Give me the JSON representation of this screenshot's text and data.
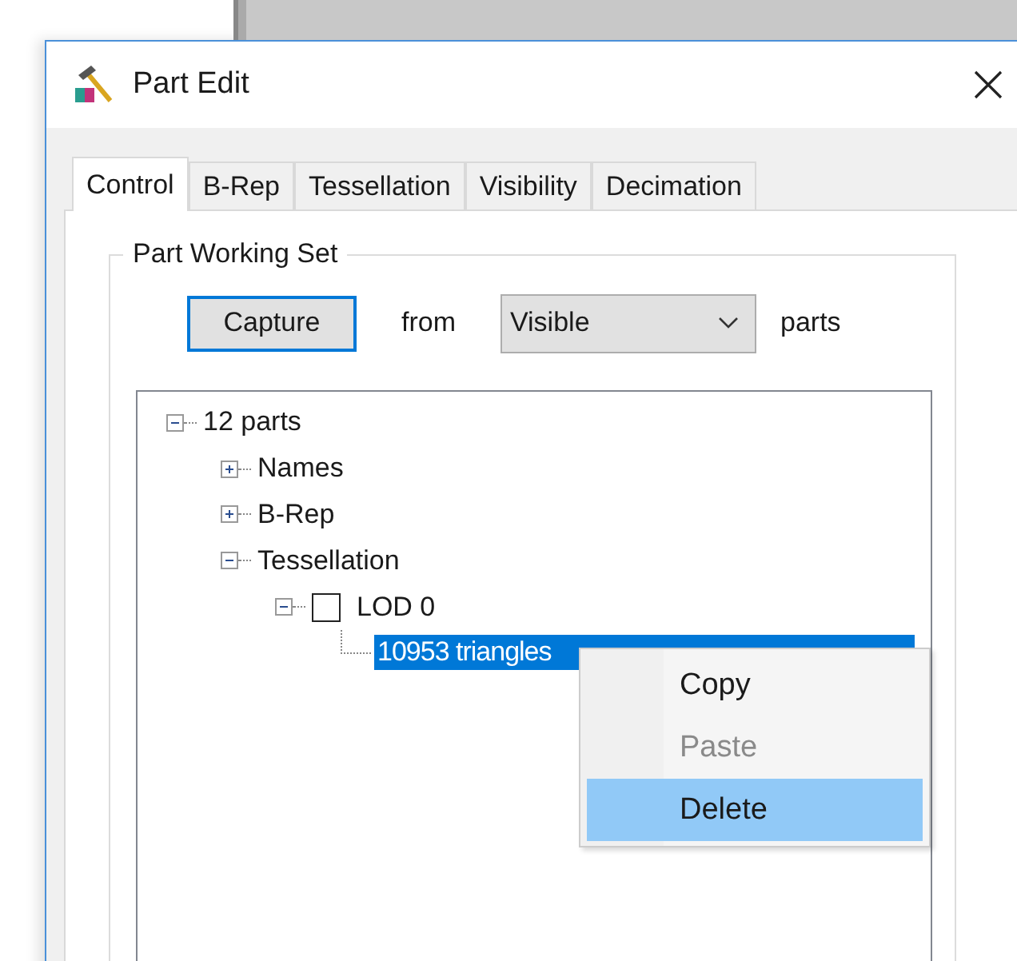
{
  "window": {
    "title": "Part Edit"
  },
  "tabs": [
    {
      "label": "Control",
      "selected": true
    },
    {
      "label": "B-Rep",
      "selected": false
    },
    {
      "label": "Tessellation",
      "selected": false
    },
    {
      "label": "Visibility",
      "selected": false
    },
    {
      "label": "Decimation",
      "selected": false
    }
  ],
  "group": {
    "title": "Part Working Set",
    "capture_button": "Capture",
    "from_label": "from",
    "source": {
      "value": "Visible"
    },
    "suffix": "parts"
  },
  "tree": [
    {
      "label": "12 parts",
      "expanded": true,
      "selected": false,
      "children": [
        {
          "label": "Names",
          "expanded": false,
          "selected": false
        },
        {
          "label": "B-Rep",
          "expanded": false,
          "selected": false
        },
        {
          "label": "Tessellation",
          "expanded": true,
          "selected": false,
          "children": [
            {
              "label": "LOD 0",
              "expanded": true,
              "checked": false,
              "selected": false,
              "children": [
                {
                  "label": "10953 triangles",
                  "selected": true
                }
              ]
            }
          ]
        }
      ]
    }
  ],
  "context_menu": [
    {
      "label": "Copy",
      "disabled": false,
      "selected": false
    },
    {
      "label": "Paste",
      "disabled": true,
      "selected": false
    },
    {
      "label": "Delete",
      "disabled": false,
      "selected": true
    }
  ]
}
